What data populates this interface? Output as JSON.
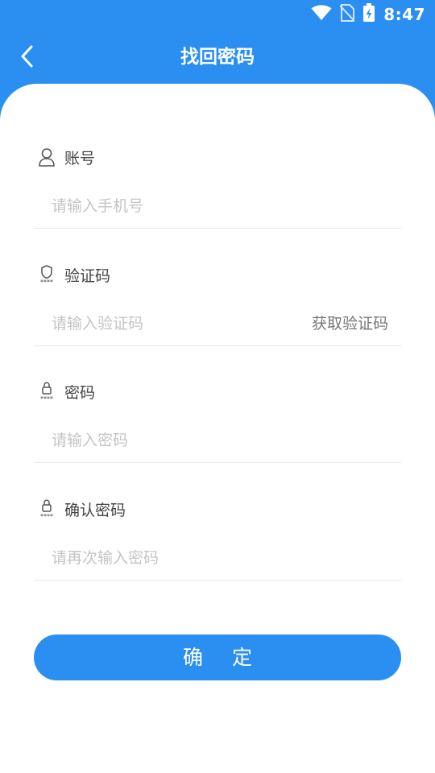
{
  "status_bar": {
    "time": "8:47"
  },
  "header": {
    "title": "找回密码"
  },
  "form": {
    "account": {
      "label": "账号",
      "placeholder": "请输入手机号",
      "value": ""
    },
    "code": {
      "label": "验证码",
      "placeholder": "请输入验证码",
      "value": "",
      "get_code_label": "获取验证码"
    },
    "password": {
      "label": "密码",
      "placeholder": "请输入密码",
      "value": ""
    },
    "confirm": {
      "label": "确认密码",
      "placeholder": "请再次输入密码",
      "value": ""
    }
  },
  "submit_label": "确 定",
  "colors": {
    "primary": "#2b8ff2",
    "card": "#ffffff",
    "placeholder": "#c4c4c4",
    "label": "#444444"
  }
}
